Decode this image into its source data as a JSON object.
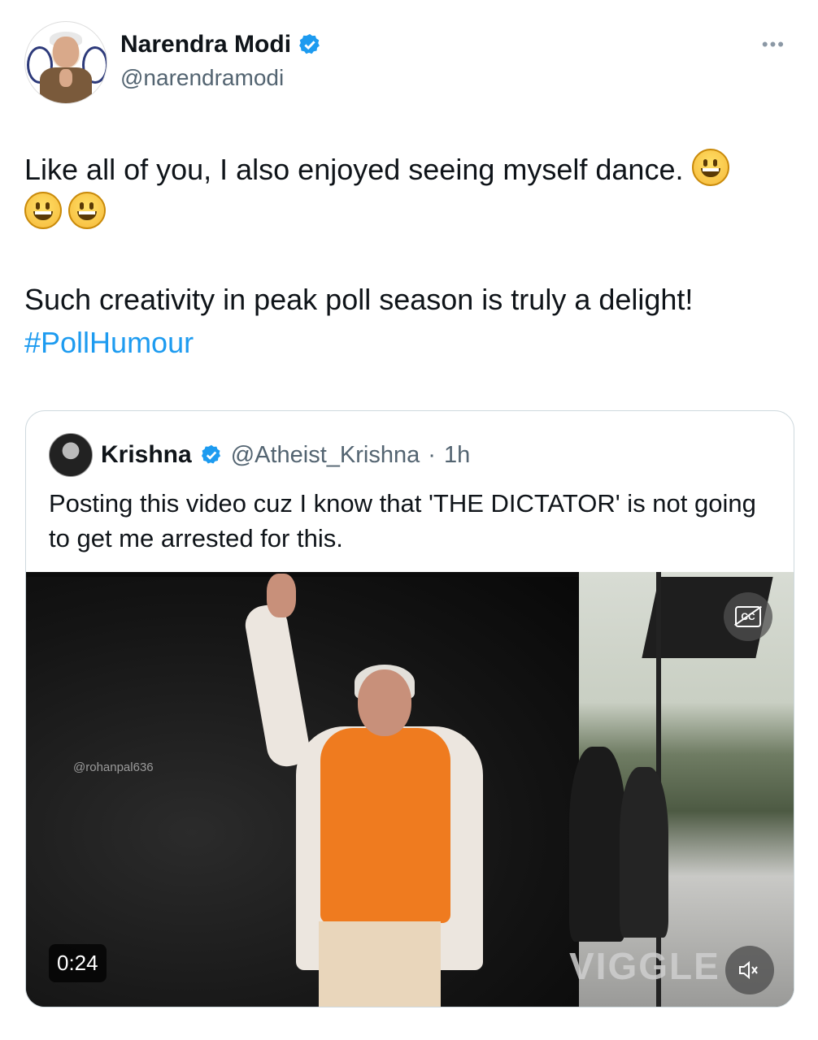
{
  "author": {
    "name": "Narendra Modi",
    "handle": "@narendramodi",
    "verified_icon": "verified-badge-icon"
  },
  "more_label": "•••",
  "tweet": {
    "line1": "Like all of you, I also enjoyed seeing myself dance.",
    "line2": "Such creativity in peak poll season is truly a delight!",
    "hashtag": "#PollHumour",
    "emoji_icon": "grinning-face-icon"
  },
  "quoted": {
    "name": "Krishna",
    "handle": "@Atheist_Krishna",
    "separator": "·",
    "time": "1h",
    "text": "Posting this video cuz I know that 'THE DICTATOR' is not going to get me arrested for this."
  },
  "video": {
    "watermark": "@rohanpal636",
    "overlay_logo": "VIGGLE",
    "duration": "0:24",
    "cc_icon": "captions-off-icon",
    "mute_icon": "muted-speaker-icon"
  },
  "colors": {
    "link": "#1d9bf0",
    "secondary_text": "#536471",
    "verified": "#1d9bf0",
    "border": "#cfd9de"
  }
}
